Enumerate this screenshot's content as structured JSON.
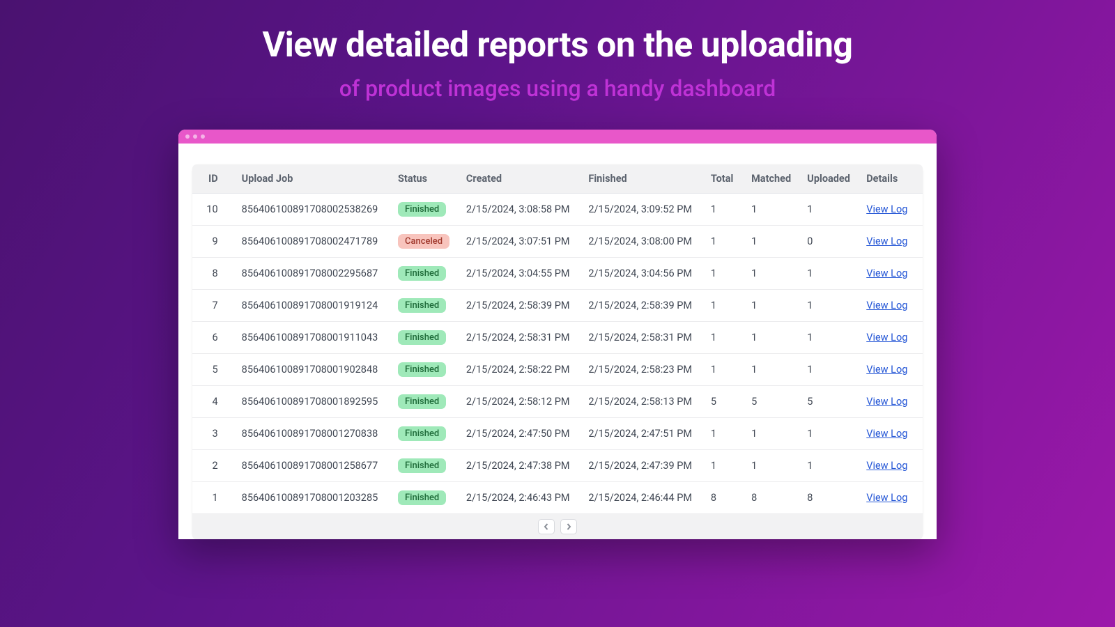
{
  "hero": {
    "title": "View detailed reports on the uploading",
    "subtitle": "of product images using a handy dashboard"
  },
  "table": {
    "headers": {
      "id": "ID",
      "upload_job": "Upload Job",
      "status": "Status",
      "created": "Created",
      "finished": "Finished",
      "total": "Total",
      "matched": "Matched",
      "uploaded": "Uploaded",
      "details": "Details"
    },
    "view_log_label": "View Log",
    "status_labels": {
      "finished": "Finished",
      "canceled": "Canceled"
    },
    "rows": [
      {
        "id": "10",
        "job": "856406100891708002538269",
        "status": "finished",
        "created": "2/15/2024, 3:08:58 PM",
        "finished": "2/15/2024, 3:09:52 PM",
        "total": "1",
        "matched": "1",
        "uploaded": "1"
      },
      {
        "id": "9",
        "job": "856406100891708002471789",
        "status": "canceled",
        "created": "2/15/2024, 3:07:51 PM",
        "finished": "2/15/2024, 3:08:00 PM",
        "total": "1",
        "matched": "1",
        "uploaded": "0"
      },
      {
        "id": "8",
        "job": "856406100891708002295687",
        "status": "finished",
        "created": "2/15/2024, 3:04:55 PM",
        "finished": "2/15/2024, 3:04:56 PM",
        "total": "1",
        "matched": "1",
        "uploaded": "1"
      },
      {
        "id": "7",
        "job": "856406100891708001919124",
        "status": "finished",
        "created": "2/15/2024, 2:58:39 PM",
        "finished": "2/15/2024, 2:58:39 PM",
        "total": "1",
        "matched": "1",
        "uploaded": "1"
      },
      {
        "id": "6",
        "job": "856406100891708001911043",
        "status": "finished",
        "created": "2/15/2024, 2:58:31 PM",
        "finished": "2/15/2024, 2:58:31 PM",
        "total": "1",
        "matched": "1",
        "uploaded": "1"
      },
      {
        "id": "5",
        "job": "856406100891708001902848",
        "status": "finished",
        "created": "2/15/2024, 2:58:22 PM",
        "finished": "2/15/2024, 2:58:23 PM",
        "total": "1",
        "matched": "1",
        "uploaded": "1"
      },
      {
        "id": "4",
        "job": "856406100891708001892595",
        "status": "finished",
        "created": "2/15/2024, 2:58:12 PM",
        "finished": "2/15/2024, 2:58:13 PM",
        "total": "5",
        "matched": "5",
        "uploaded": "5"
      },
      {
        "id": "3",
        "job": "856406100891708001270838",
        "status": "finished",
        "created": "2/15/2024, 2:47:50 PM",
        "finished": "2/15/2024, 2:47:51 PM",
        "total": "1",
        "matched": "1",
        "uploaded": "1"
      },
      {
        "id": "2",
        "job": "856406100891708001258677",
        "status": "finished",
        "created": "2/15/2024, 2:47:38 PM",
        "finished": "2/15/2024, 2:47:39 PM",
        "total": "1",
        "matched": "1",
        "uploaded": "1"
      },
      {
        "id": "1",
        "job": "856406100891708001203285",
        "status": "finished",
        "created": "2/15/2024, 2:46:43 PM",
        "finished": "2/15/2024, 2:46:44 PM",
        "total": "8",
        "matched": "8",
        "uploaded": "8"
      }
    ]
  }
}
